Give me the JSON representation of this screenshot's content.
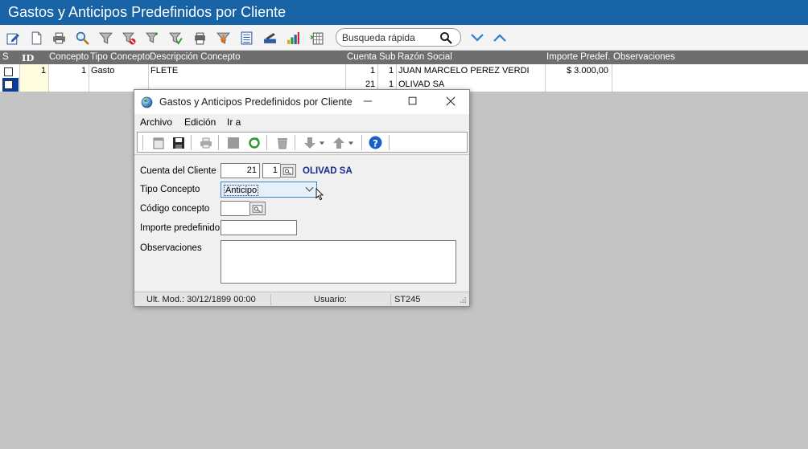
{
  "window": {
    "title": "Gastos y Anticipos Predefinidos por Cliente"
  },
  "toolbar": {
    "icons": [
      "edit-icon",
      "new-document-icon",
      "print-icon",
      "search-icon",
      "filter-icon",
      "filter-clear-icon",
      "filter-add-icon",
      "filter-apply-icon",
      "print-preview-icon",
      "export-icon",
      "list-view-icon",
      "edit-record-icon",
      "chart-icon",
      "columns-icon"
    ],
    "search_placeholder": "Busqueda rápida"
  },
  "grid": {
    "columns": [
      "S",
      "ID",
      "Concepto",
      "Tipo Concepto",
      "Descripción Concepto",
      "Cuenta",
      "Sub",
      "Razón Social",
      "Importe Predef.",
      "Observaciones"
    ],
    "rows": [
      {
        "id": "1",
        "concepto": "1",
        "tipo": "Gasto",
        "descripcion": "FLETE",
        "cuenta": "1",
        "sub": "1",
        "razon": "JUAN MARCELO PEREZ VERDI",
        "importe": "$ 3.000,00",
        "obs": ""
      },
      {
        "id": "",
        "concepto": "",
        "tipo": "",
        "descripcion": "",
        "cuenta": "21",
        "sub": "1",
        "razon": "OLIVAD SA",
        "importe": "",
        "obs": ""
      }
    ]
  },
  "dialog": {
    "title": "Gastos y Anticipos Predefinidos por Cliente",
    "menu": [
      "Archivo",
      "Edición",
      "Ir a"
    ],
    "fields": {
      "cuenta_label": "Cuenta del Cliente",
      "cuenta_value": "21",
      "sub_value": "1",
      "cliente_name": "OLIVAD SA",
      "tipo_label": "Tipo Concepto",
      "tipo_value": "Anticipo",
      "codigo_label": "Código concepto",
      "importe_label": "Importe predefinido",
      "obs_label": "Observaciones"
    },
    "status": {
      "ult_mod": "Ult. Mod.: 30/12/1899 00:00",
      "usuario_label": "Usuario:",
      "usuario_value": "ST245"
    }
  },
  "colors": {
    "title_bar": "#1763a6",
    "grid_header": "#6e6e6e",
    "client_name": "#1a2a8a",
    "selected_row": "#0a3c9c"
  }
}
